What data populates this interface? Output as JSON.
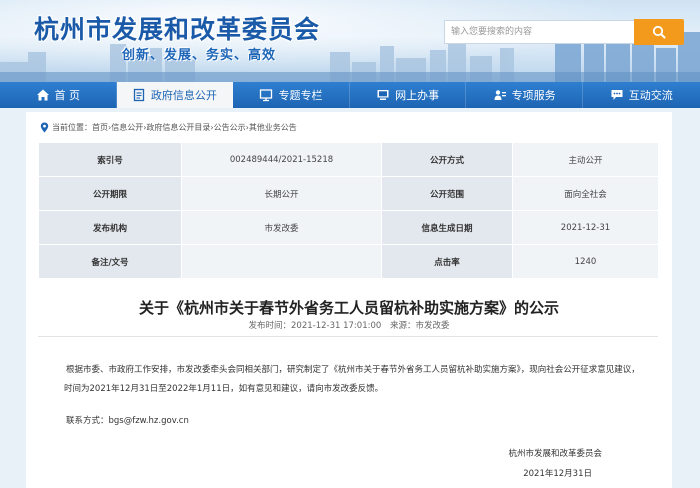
{
  "header": {
    "site_title": "杭州市发展和改革委员会",
    "slogan": "创新、发展、务实、高效",
    "search_placeholder": "输入您要搜索的内容",
    "search_icon": "search-icon"
  },
  "nav": {
    "items": [
      {
        "label": "首 页",
        "icon": "home-icon"
      },
      {
        "label": "政府信息公开",
        "icon": "document-icon"
      },
      {
        "label": "专题专栏",
        "icon": "monitor-icon"
      },
      {
        "label": "网上办事",
        "icon": "computer-icon"
      },
      {
        "label": "专项服务",
        "icon": "service-icon"
      },
      {
        "label": "互动交流",
        "icon": "chat-icon"
      }
    ],
    "active_index": 1
  },
  "breadcrumb": {
    "prefix": "当前位置：",
    "items": [
      "首页",
      "信息公开",
      "政府信息公开目录",
      "公告公示",
      "其他业务公告"
    ],
    "separator": " › "
  },
  "info": {
    "index_label": "索引号",
    "index_value": "002489444/2021-15218",
    "method_label": "公开方式",
    "method_value": "主动公开",
    "period_label": "公开期限",
    "period_value": "长期公开",
    "scope_label": "公开范围",
    "scope_value": "面向全社会",
    "issuer_label": "发布机构",
    "issuer_value": "市发改委",
    "date_label": "信息生成日期",
    "date_value": "2021-12-31",
    "docno_label": "备注/文号",
    "docno_value": "",
    "clicks_label": "点击率",
    "clicks_value": "1240"
  },
  "article": {
    "title": "关于《杭州市关于春节外省务工人员留杭补助实施方案》的公示",
    "publish_time": "发布时间：2021-12-31 17:01:00",
    "source": "来源：市发改委",
    "para1_line1": "根据市委、市政府工作安排，市发改委牵头会同相关部门，研究制定了《杭州市关于春节外省务工人员留杭补助实施方案》，现向社会公开征求意见建议，",
    "para1_line2": "时间为2021年12月31日至2022年1月11日，如有意见和建议，请向市发改委反馈。",
    "contact": "联系方式：bgs@fzw.hz.gov.cn",
    "signature_org": "杭州市发展和改革委员会",
    "signature_date": "2021年12月31日"
  },
  "colors": {
    "brand_blue": "#1d64b3",
    "search_orange": "#f39a1c",
    "table_key_bg": "#e3e8ee",
    "table_value_bg": "#f1f4f7"
  }
}
